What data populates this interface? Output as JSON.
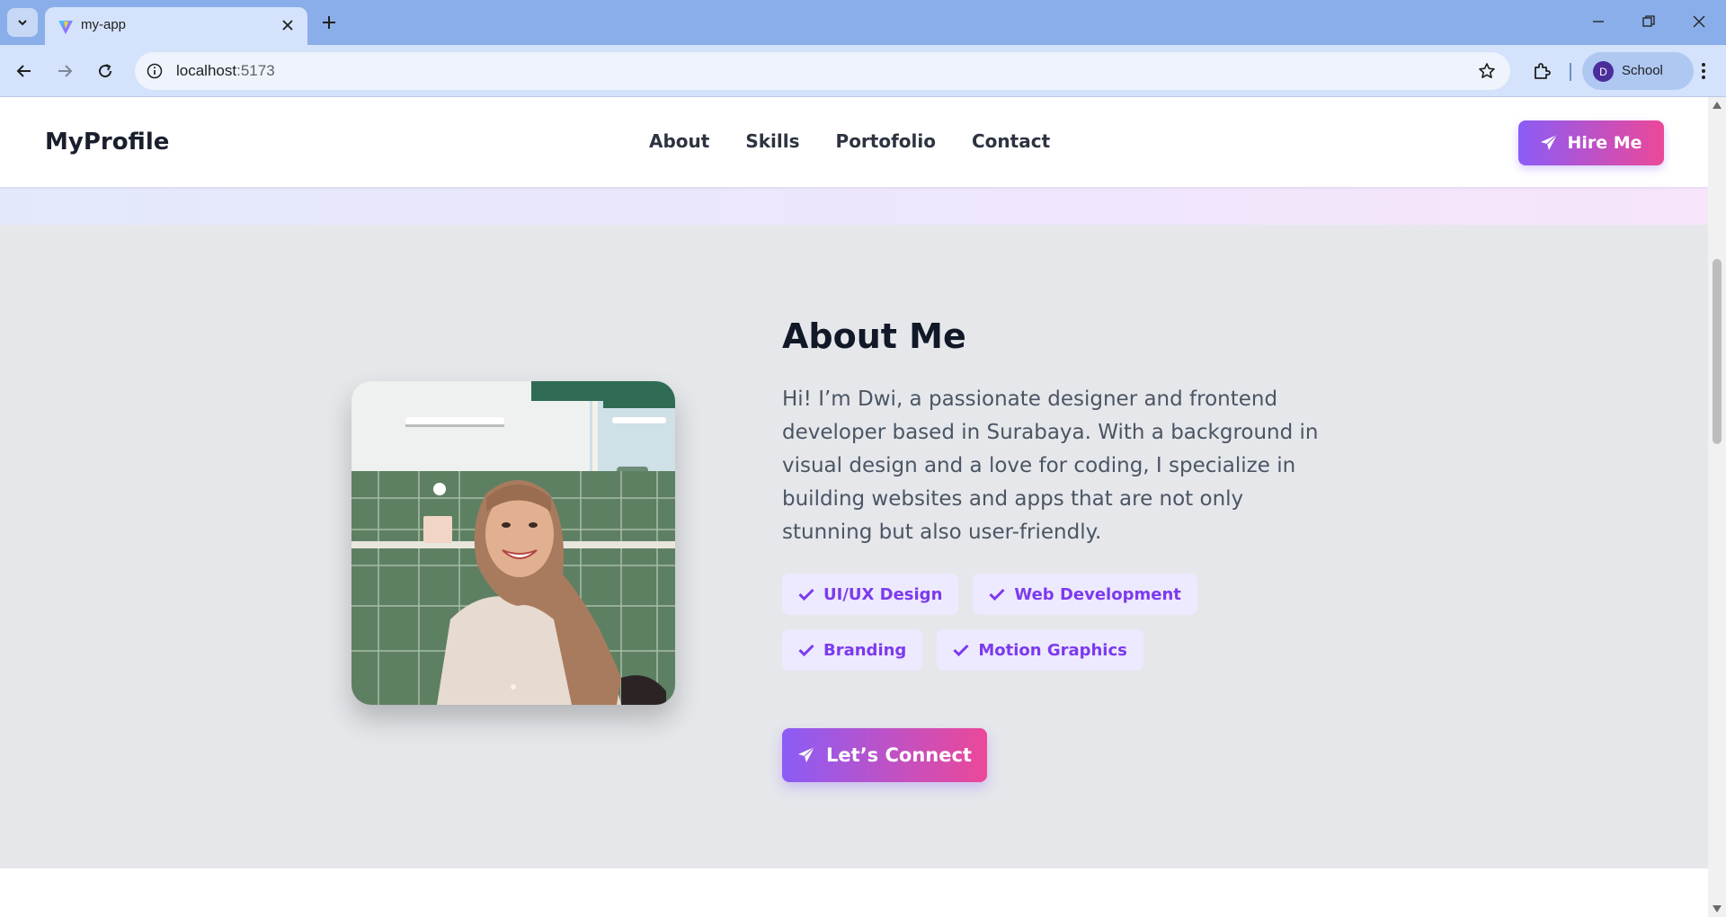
{
  "browser": {
    "tab_title": "my-app",
    "url_host": "localhost",
    "url_port": ":5173",
    "profile_initial": "D",
    "profile_name": "School"
  },
  "site": {
    "logo": "MyProfile",
    "nav": [
      "About",
      "Skills",
      "Portofolio",
      "Contact"
    ],
    "hire_label": "Hire Me"
  },
  "about": {
    "title": "About Me",
    "text": "Hi! I’m Dwi, a passionate designer and frontend developer based in Surabaya. With a background in visual design and a love for coding, I specialize in building websites and apps that are not only stunning but also user-friendly.",
    "skills": [
      "UI/UX Design",
      "Web Development",
      "Branding",
      "Motion Graphics"
    ],
    "cta_label": "Let’s Connect"
  },
  "colors": {
    "accent_start": "#8b5cf6",
    "accent_end": "#ec4899",
    "chip_bg": "#ede9fe",
    "chip_text": "#7c3aed",
    "section_bg": "#e5e7eb"
  },
  "icons": {
    "send": "paper-plane-icon",
    "check": "check-icon"
  }
}
